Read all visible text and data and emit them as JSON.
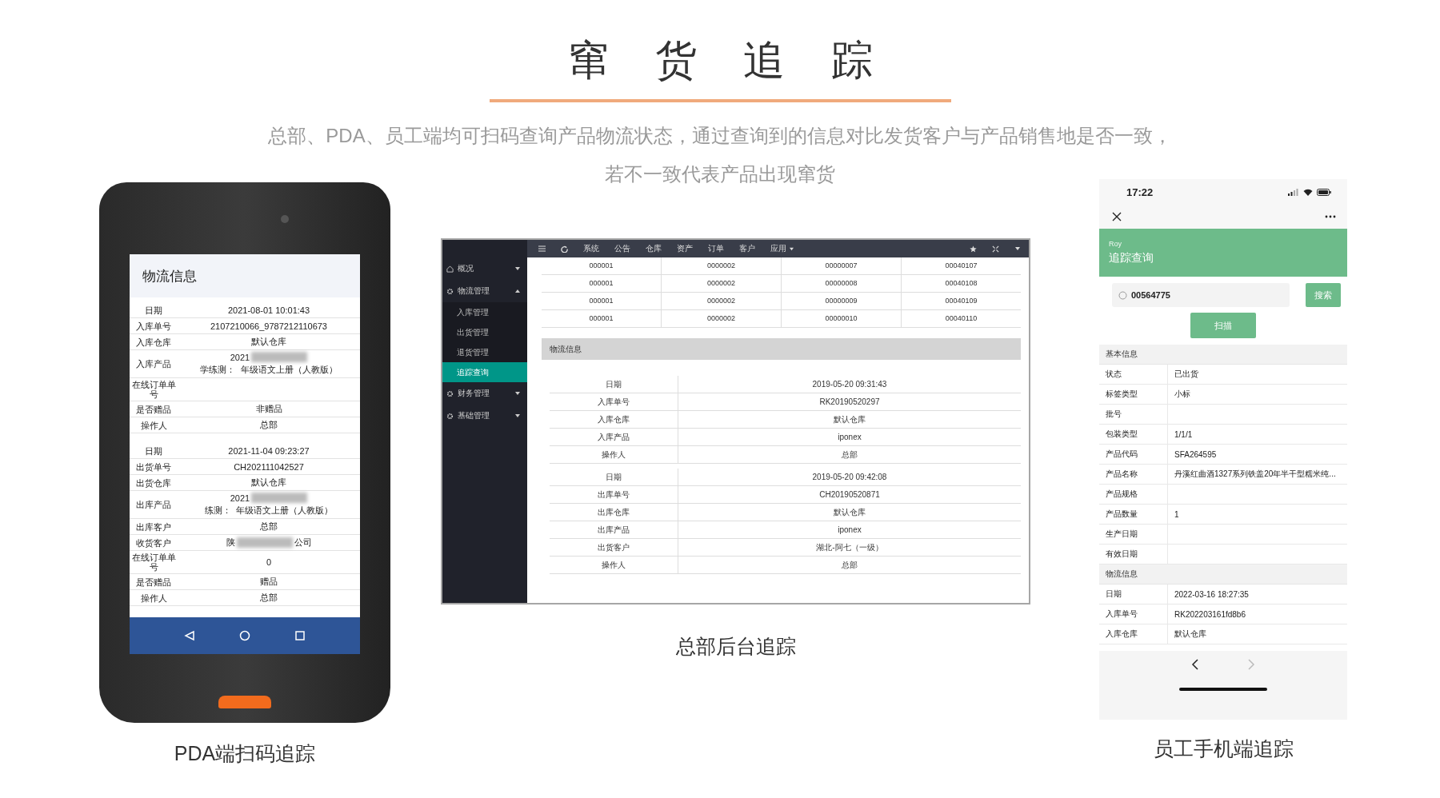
{
  "header": {
    "title": "窜货追踪",
    "subtitle_lines": [
      "总部、PDA、员工端均可扫码查询产品物流状态，通过查询到的信息对比发货客户与产品销售地是否一致，",
      "若不一致代表产品出现窜货"
    ]
  },
  "pda": {
    "screen_title": "物流信息",
    "caption": "PDA端扫码追踪",
    "groups": [
      {
        "rows": [
          {
            "label": "日期",
            "value": "2021-08-01 10:01:43"
          },
          {
            "label": "入库单号",
            "value": "2107210066_9787212110673"
          },
          {
            "label": "入库仓库",
            "value": "默认仓库"
          },
          {
            "label": "入库产品",
            "value": "2021",
            "redacted": true,
            "value_after": "学练测：  年级语文上册（人教版）"
          },
          {
            "label": "在线订单单号"
          },
          {
            "label": "是否赠品",
            "value": "非赠品"
          },
          {
            "label": "操作人",
            "value": "总部"
          }
        ]
      },
      {
        "rows": [
          {
            "label": "日期",
            "value": "2021-11-04 09:23:27"
          },
          {
            "label": "出货单号",
            "value": "CH202111042527"
          },
          {
            "label": "出货仓库",
            "value": "默认仓库"
          },
          {
            "label": "出库产品",
            "value": "2021",
            "redacted": true,
            "value_after": "练测：  年级语文上册（人教版）"
          },
          {
            "label": "出库客户",
            "value": "总部"
          },
          {
            "label": "收货客户",
            "value": "陕",
            "redacted": true,
            "value_after": "公司"
          },
          {
            "label": "在线订单单号",
            "value": "0"
          },
          {
            "label": "是否赠品",
            "value": "赠品"
          },
          {
            "label": "操作人",
            "value": "总部"
          }
        ]
      }
    ]
  },
  "admin": {
    "caption": "总部后台追踪",
    "sidebar": [
      {
        "kind": "group",
        "label": "概况",
        "expanded": false
      },
      {
        "kind": "group",
        "label": "物流管理",
        "expanded": true
      },
      {
        "kind": "sub",
        "label": "入库管理",
        "selected": false
      },
      {
        "kind": "sub",
        "label": "出货管理",
        "selected": false
      },
      {
        "kind": "sub",
        "label": "退货管理",
        "selected": false
      },
      {
        "kind": "sub",
        "label": "追踪查询",
        "selected": true
      },
      {
        "kind": "group",
        "label": "财务管理",
        "expanded": false
      },
      {
        "kind": "group",
        "label": "基础管理",
        "expanded": false
      }
    ],
    "nav": [
      "系统",
      "公告",
      "仓库",
      "资产",
      "订单",
      "客户"
    ],
    "nav_menu": "应用",
    "table_rows": [
      [
        "000001",
        "0000002",
        "00000007",
        "00040107"
      ],
      [
        "000001",
        "0000002",
        "00000008",
        "00040108"
      ],
      [
        "000001",
        "0000002",
        "00000009",
        "00040109"
      ],
      [
        "000001",
        "0000002",
        "00000010",
        "00040110"
      ]
    ],
    "section_title": "物流信息",
    "detail_groups": [
      {
        "rows": [
          {
            "label": "日期",
            "value": "2019-05-20 09:31:43"
          },
          {
            "label": "入库单号",
            "value": "RK20190520297"
          },
          {
            "label": "入库仓库",
            "value": "默认仓库"
          },
          {
            "label": "入库产品",
            "value": "iponex"
          },
          {
            "label": "操作人",
            "value": "总部"
          }
        ]
      },
      {
        "rows": [
          {
            "label": "日期",
            "value": "2019-05-20 09:42:08"
          },
          {
            "label": "出库单号",
            "value": "CH20190520871"
          },
          {
            "label": "出库仓库",
            "value": "默认仓库"
          },
          {
            "label": "出库产品",
            "value": "iponex"
          },
          {
            "label": "出货客户",
            "value": "湖北-阿七（一级）"
          },
          {
            "label": "操作人",
            "value": "总部"
          }
        ]
      }
    ]
  },
  "phone": {
    "caption": "员工手机端追踪",
    "time": "17:22",
    "user": "Roy",
    "page_title": "追踪查询",
    "search_value": "00564775",
    "search_button": "搜索",
    "scan_button": "扫描",
    "sections": [
      {
        "title": "基本信息",
        "rows": [
          {
            "label": "状态",
            "value": "已出货"
          },
          {
            "label": "标签类型",
            "value": "小标"
          },
          {
            "label": "批号"
          },
          {
            "label": "包装类型",
            "value": "1/1/1"
          },
          {
            "label": "产品代码",
            "value": "SFA264595"
          },
          {
            "label": "产品名称",
            "value": "丹溪红曲酒1327系列铁盖20年半干型糯米纯..."
          },
          {
            "label": "产品规格"
          },
          {
            "label": "产品数量",
            "value": "1"
          },
          {
            "label": "生产日期"
          },
          {
            "label": "有效日期"
          }
        ]
      },
      {
        "title": "物流信息",
        "rows": [
          {
            "label": "日期",
            "value": "2022-03-16 18:27:35"
          },
          {
            "label": "入库单号",
            "value": "RK202203161fd8b6"
          },
          {
            "label": "入库仓库",
            "value": "默认仓库"
          }
        ]
      }
    ]
  }
}
